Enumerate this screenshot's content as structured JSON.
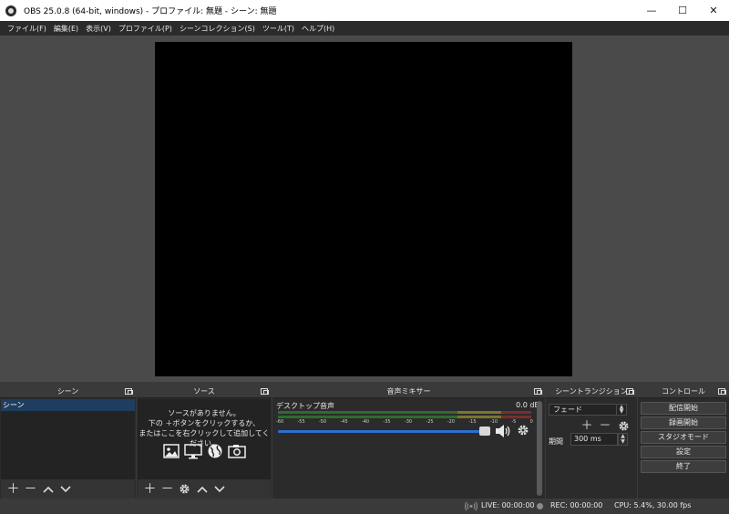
{
  "window": {
    "title": "OBS 25.0.8 (64-bit, windows) - プロファイル: 無題 - シーン: 無題",
    "minimize": "—",
    "maximize": "☐",
    "close": "✕"
  },
  "menu": [
    "ファイル(F)",
    "編集(E)",
    "表示(V)",
    "プロファイル(P)",
    "シーンコレクション(S)",
    "ツール(T)",
    "ヘルプ(H)"
  ],
  "docks": {
    "scenes": {
      "title": "シーン",
      "items": [
        "シーン"
      ]
    },
    "sources": {
      "title": "ソース",
      "empty_line1": "ソースがありません。",
      "empty_line2": "下の ＋ボタンをクリックするか、",
      "empty_line3": "またはここを右クリックして追加してください。"
    },
    "mixer": {
      "title": "音声ミキサー",
      "channel_name": "デスクトップ音声",
      "channel_db": "0.0 dB",
      "ticks": [
        "-60",
        "-55",
        "-50",
        "-45",
        "-40",
        "-35",
        "-30",
        "-25",
        "-20",
        "-15",
        "-10",
        "-5",
        "0"
      ],
      "volume_level": 0.97
    },
    "transitions": {
      "title": "シーントランジション",
      "selected": "フェード",
      "duration_label": "期間",
      "duration_value": "300 ms"
    },
    "controls": {
      "title": "コントロール",
      "buttons": [
        "配信開始",
        "録画開始",
        "スタジオモード",
        "設定",
        "終了"
      ]
    }
  },
  "status": {
    "live": "LIVE: 00:00:00",
    "rec": "REC: 00:00:00",
    "cpu": "CPU: 5.4%, 30.00 fps"
  },
  "colors": {
    "panel": "#2b2b2b",
    "selection": "#1f3d5f",
    "volume": "#2d6fcb"
  }
}
